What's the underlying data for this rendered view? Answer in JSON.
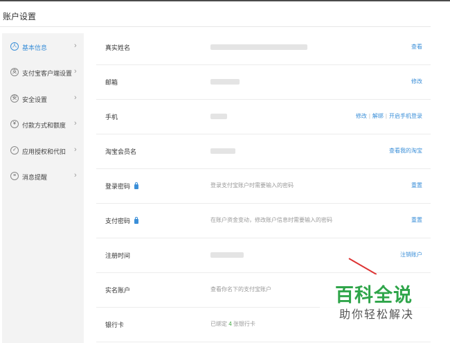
{
  "page": {
    "title": "账户设置"
  },
  "sidebar": {
    "items": [
      {
        "label": "基本信息",
        "icon": "user-icon",
        "glyph": "人",
        "active": true
      },
      {
        "label": "支付宝客户端设置",
        "icon": "app-icon",
        "glyph": "支",
        "active": false
      },
      {
        "label": "安全设置",
        "icon": "shield-icon",
        "glyph": "安",
        "active": false
      },
      {
        "label": "付款方式和额度",
        "icon": "yuan-icon",
        "glyph": "¥",
        "active": false
      },
      {
        "label": "应用授权和代扣",
        "icon": "check-icon",
        "glyph": "✓",
        "active": false
      },
      {
        "label": "消息提醒",
        "icon": "message-icon",
        "glyph": "≡",
        "active": false
      }
    ],
    "chevron": "›"
  },
  "rows": [
    {
      "label": "真实姓名",
      "value": "",
      "actions": [
        "查看"
      ]
    },
    {
      "label": "邮箱",
      "value": "",
      "actions": [
        "修改"
      ]
    },
    {
      "label": "手机",
      "value": "",
      "actions": [
        "修改",
        "解绑",
        "开启手机登录"
      ]
    },
    {
      "label": "淘宝会员名",
      "value": "",
      "actions": [
        "查看我的淘宝"
      ]
    },
    {
      "label": "登录密码",
      "lock": true,
      "value": "登录支付宝账户时需要输入的密码",
      "actions": [
        "重置"
      ]
    },
    {
      "label": "支付密码",
      "lock": true,
      "value": "在账户资金变动，修改账户信息时需要输入的密码",
      "actions": [
        "重置"
      ]
    },
    {
      "label": "注册时间",
      "value": "",
      "actions": [
        "注销账户"
      ]
    },
    {
      "label": "实名账户",
      "value": "查看你名下的支付宝账户",
      "actions": []
    },
    {
      "label": "银行卡",
      "value_prefix": "已绑定",
      "value_count": "4",
      "value_suffix": "张银行卡",
      "actions": []
    }
  ],
  "separator": "|",
  "watermark": {
    "title": "百科全说",
    "subtitle": "助你轻松解决"
  },
  "colors": {
    "link": "#3b8fd8",
    "active": "#3b8fd8",
    "sidebar_bg": "#f3f3f3",
    "watermark_green": "#2fa54a"
  }
}
